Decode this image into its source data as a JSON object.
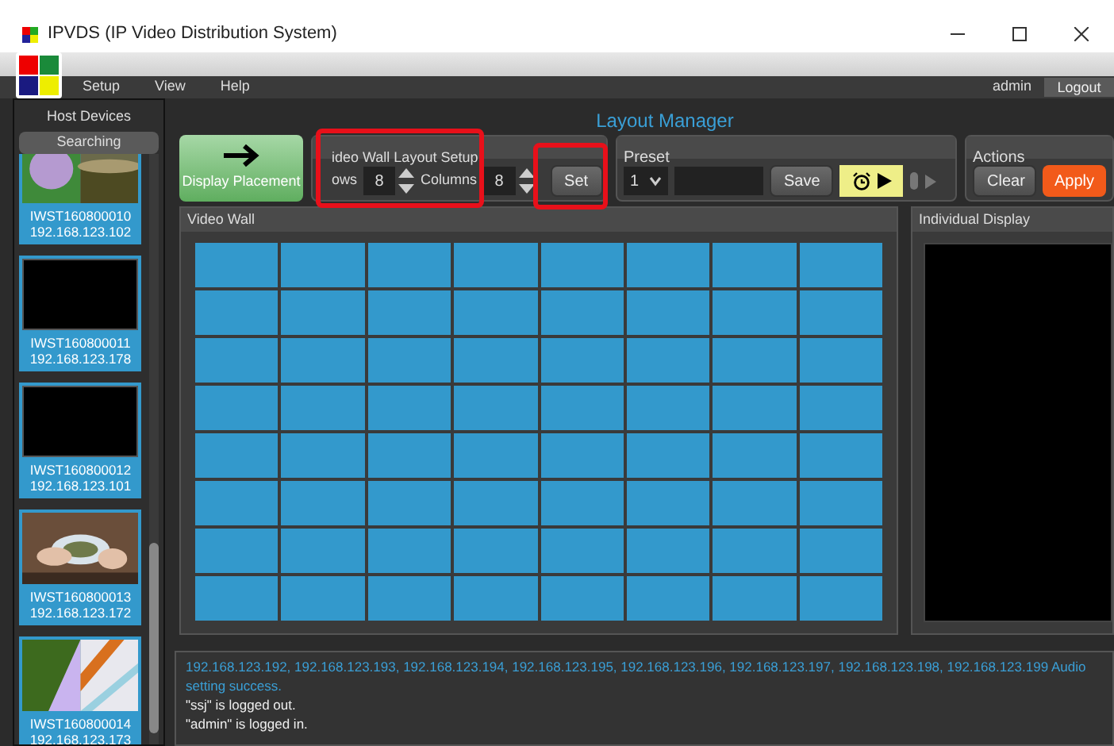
{
  "window": {
    "title": "IPVDS (IP Video Distribution System)"
  },
  "menu": [
    "Setup",
    "View",
    "Help"
  ],
  "user": {
    "name": "admin",
    "logout": "Logout"
  },
  "sidebar": {
    "title": "Host Devices",
    "status_button": "Searching",
    "devices": [
      {
        "name": "IWST160800010",
        "ip": "192.168.123.102"
      },
      {
        "name": "IWST160800011",
        "ip": "192.168.123.178"
      },
      {
        "name": "IWST160800012",
        "ip": "192.168.123.101"
      },
      {
        "name": "IWST160800013",
        "ip": "192.168.123.172"
      },
      {
        "name": "IWST160800014",
        "ip": "192.168.123.173"
      }
    ]
  },
  "page_title": "Layout Manager",
  "display_placement": {
    "label": "Display Placement"
  },
  "layout_setup": {
    "title": "ideo Wall Layout Setup",
    "rows_label": "ows",
    "rows": "8",
    "columns_label": "Columns",
    "columns": "8",
    "set": "Set"
  },
  "preset": {
    "title": "Preset",
    "value": "1",
    "save": "Save"
  },
  "actions": {
    "title": "Actions",
    "clear": "Clear",
    "apply": "Apply"
  },
  "video_wall": {
    "title": "Video Wall"
  },
  "individual_display": {
    "title": "Individual Display"
  },
  "log": [
    {
      "kind": "info",
      "text": "192.168.123.192, 192.168.123.193, 192.168.123.194, 192.168.123.195, 192.168.123.196, 192.168.123.197, 192.168.123.198, 192.168.123.199 Audio setting success."
    },
    {
      "kind": "plain",
      "text": "\"ssj\" is logged out."
    },
    {
      "kind": "plain",
      "text": "\"admin\" is logged in."
    }
  ]
}
